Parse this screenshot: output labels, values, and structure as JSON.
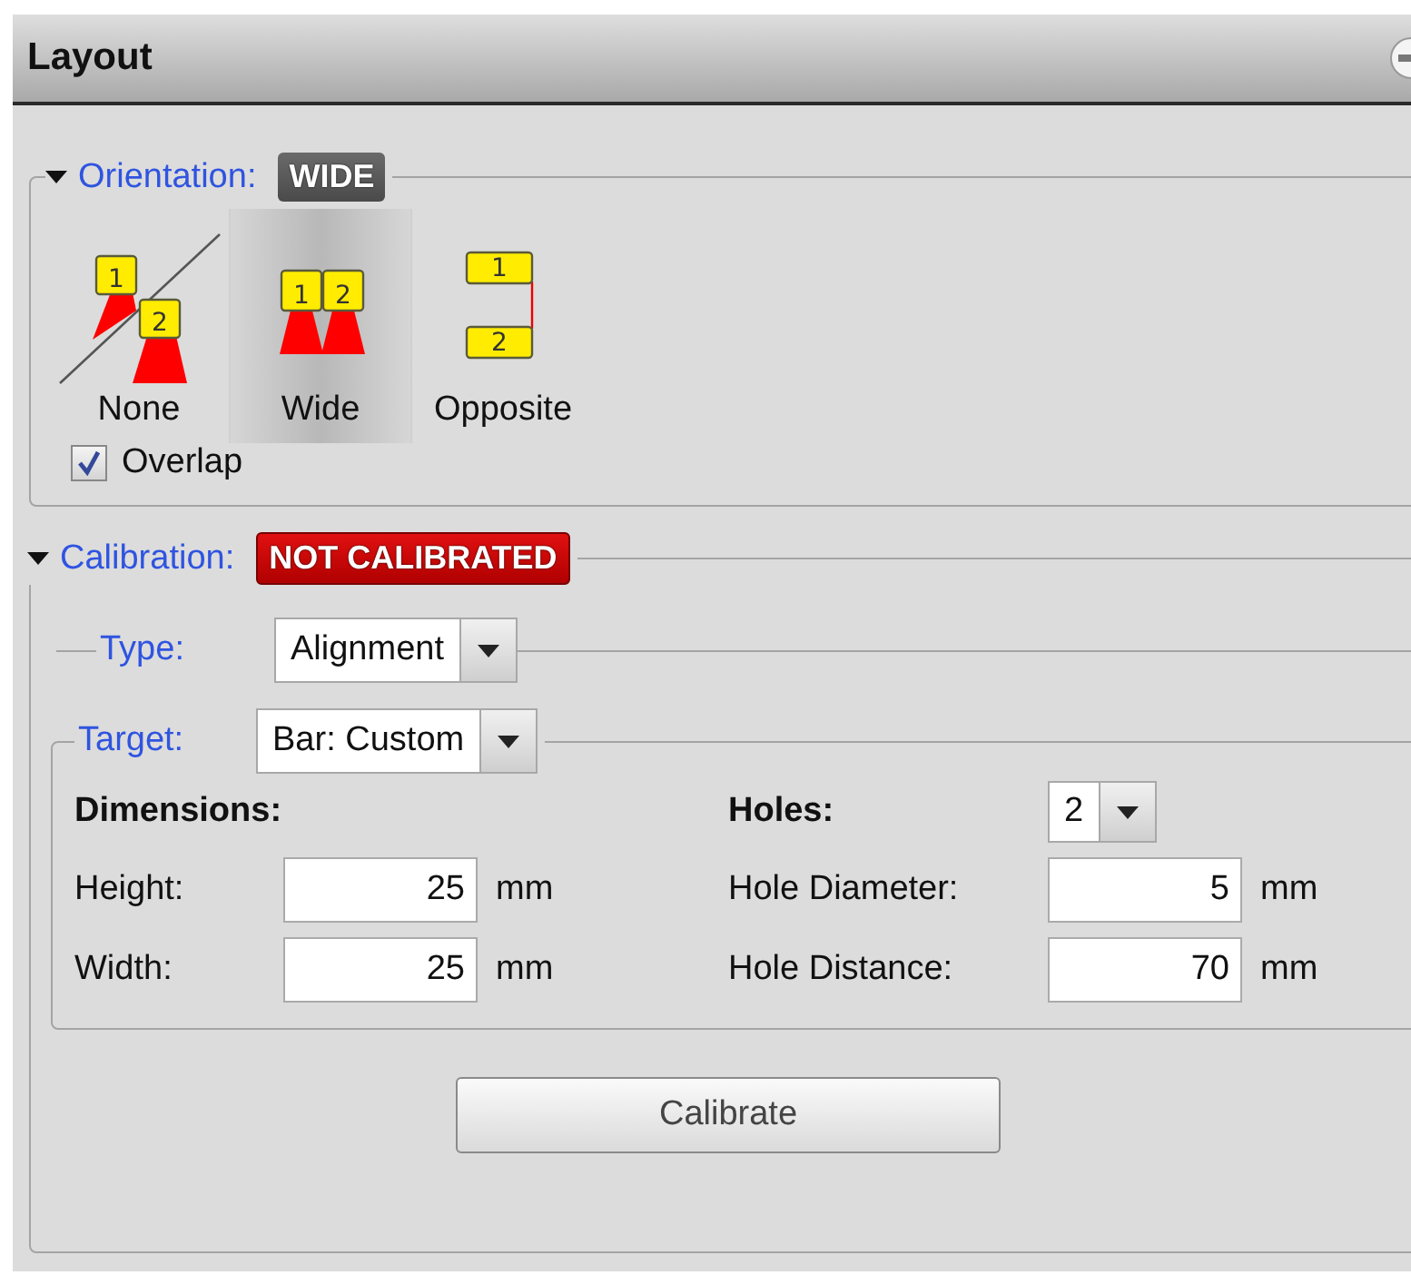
{
  "panel": {
    "title": "Layout"
  },
  "orientation": {
    "label": "Orientation:",
    "expanded": true,
    "badge": "WIDE",
    "options": [
      {
        "label": "None",
        "kind": "none",
        "selected": false,
        "markers": [
          "1",
          "2"
        ]
      },
      {
        "label": "Wide",
        "kind": "wide",
        "selected": true,
        "markers": [
          "1",
          "2"
        ]
      },
      {
        "label": "Opposite",
        "kind": "opposite",
        "selected": false,
        "markers": [
          "1",
          "2"
        ]
      }
    ],
    "overlap": {
      "label": "Overlap",
      "checked": true
    }
  },
  "calibration": {
    "label": "Calibration:",
    "expanded": true,
    "badge": "NOT CALIBRATED",
    "type": {
      "label": "Type:",
      "value": "Alignment"
    },
    "target": {
      "label": "Target:",
      "value": "Bar: Custom"
    },
    "dimensions": {
      "heading": "Dimensions:",
      "fields": [
        {
          "label": "Height:",
          "value": "25",
          "unit": "mm"
        },
        {
          "label": "Width:",
          "value": "25",
          "unit": "mm"
        }
      ]
    },
    "holes": {
      "heading": "Holes:",
      "value": "2",
      "fields": [
        {
          "label": "Hole Diameter:",
          "value": "5",
          "unit": "mm"
        },
        {
          "label": "Hole Distance:",
          "value": "70",
          "unit": "mm"
        }
      ]
    },
    "button": "Calibrate"
  }
}
